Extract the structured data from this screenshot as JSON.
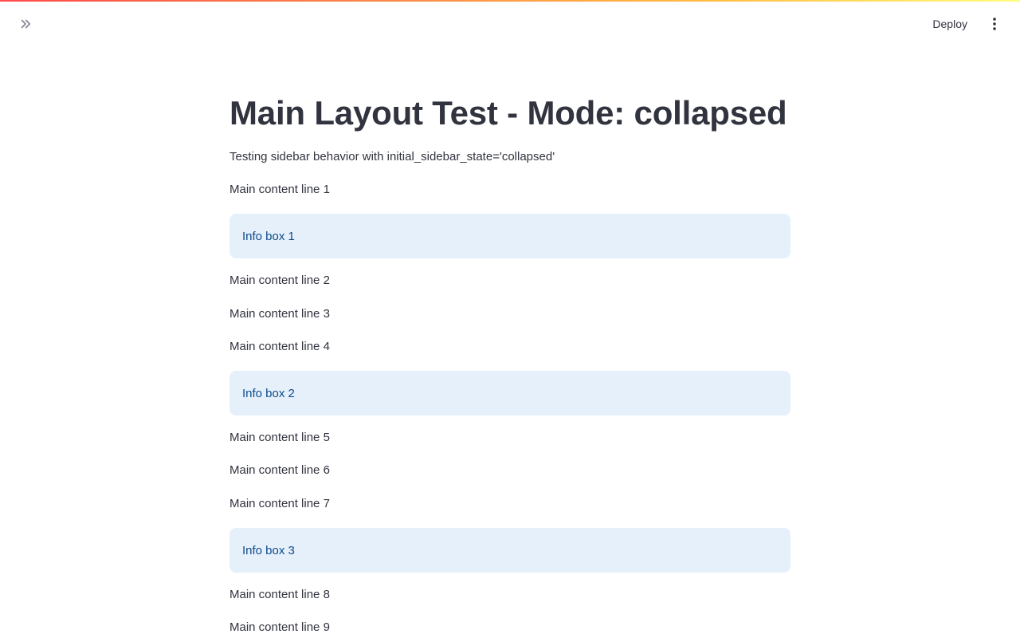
{
  "header": {
    "expand_icon": "chevrons-right-icon",
    "deploy_label": "Deploy",
    "menu_icon": "more-vertical-icon"
  },
  "main": {
    "title": "Main Layout Test - Mode: collapsed",
    "subtitle": "Testing sidebar behavior with initial_sidebar_state='collapsed'",
    "lines": [
      "Main content line 1",
      "Main content line 2",
      "Main content line 3",
      "Main content line 4",
      "Main content line 5",
      "Main content line 6",
      "Main content line 7",
      "Main content line 8",
      "Main content line 9"
    ],
    "info_boxes": [
      "Info box 1",
      "Info box 2",
      "Info box 3"
    ]
  },
  "colors": {
    "text": "#31333f",
    "info_bg": "#e6f0fb",
    "info_text": "#0d4b8c",
    "accent_red": "#ff4b4b"
  }
}
